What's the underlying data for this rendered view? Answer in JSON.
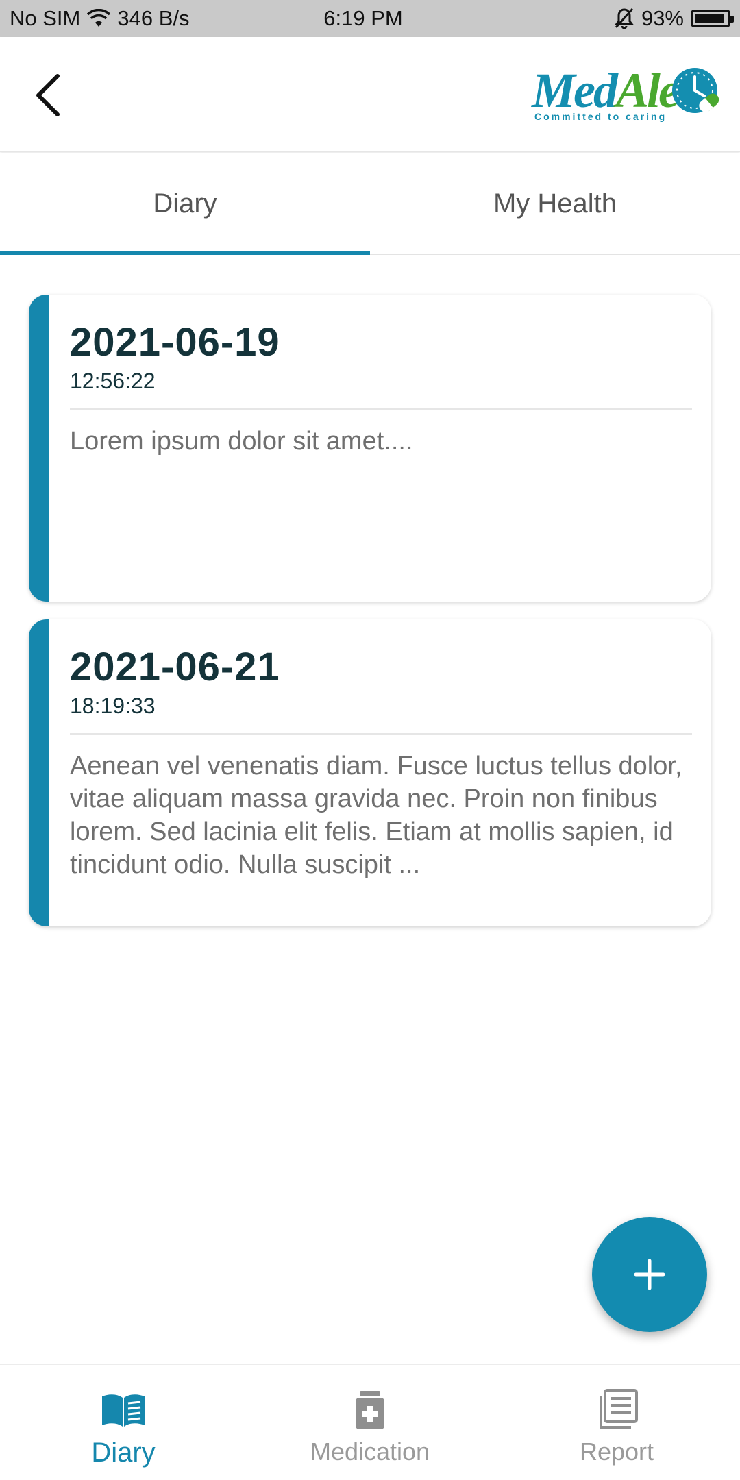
{
  "status_bar": {
    "carrier": "No SIM",
    "network_speed": "346 B/s",
    "time": "6:19 PM",
    "battery": "93%",
    "battery_level": 0.93
  },
  "header": {
    "logo_text_1": "Med",
    "logo_text_2": "Alert",
    "logo_tagline": "Committed to caring"
  },
  "tabs": [
    {
      "label": "Diary",
      "active": true
    },
    {
      "label": "My Health",
      "active": false
    }
  ],
  "entries": [
    {
      "date": "2021-06-19",
      "time": "12:56:22",
      "text": "Lorem ipsum dolor sit amet...."
    },
    {
      "date": "2021-06-21",
      "time": "18:19:33",
      "text": "Aenean vel venenatis diam. Fusce luctus tellus dolor, vitae aliquam massa gravida nec. Proin non finibus lorem. Sed lacinia elit felis. Etiam at mollis sapien, id tincidunt odio. Nulla suscipit ..."
    }
  ],
  "bottom_nav": [
    {
      "label": "Diary",
      "icon": "book-icon",
      "active": true
    },
    {
      "label": "Medication",
      "icon": "medicine-bottle-icon",
      "active": false
    },
    {
      "label": "Report",
      "icon": "report-icon",
      "active": false
    }
  ],
  "colors": {
    "accent": "#1587ad",
    "logo_green": "#4aa82f",
    "date_text": "#14333a",
    "inactive_nav": "#9a9a9a"
  }
}
